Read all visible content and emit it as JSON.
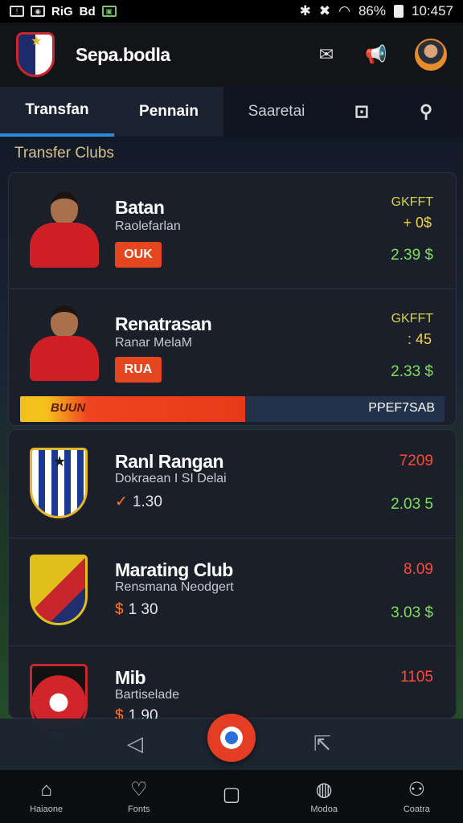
{
  "status_bar": {
    "left_icons": [
      "notification-icon",
      "camera-icon",
      "app-icon",
      "gallery-icon"
    ],
    "left_text": [
      "RiG",
      "Bd"
    ],
    "battery": "86%",
    "time": "10:457"
  },
  "app_bar": {
    "title": "Sepa.bodla",
    "actions": [
      "message-icon",
      "megaphone-icon",
      "avatar"
    ]
  },
  "tabs": [
    {
      "label": "Transfan",
      "active": true
    },
    {
      "label": "Pennain",
      "active": false
    },
    {
      "label": "Saaretai",
      "active": false
    }
  ],
  "section_label": "Transfer  Clubs",
  "players": [
    {
      "name": "Batan",
      "subtitle": "Raolefarlan",
      "badge": "OUK",
      "stat_top": "GKFFT",
      "stat_mid": "+ 0$",
      "stat_value": "2.39 $"
    },
    {
      "name": "Renatrasan",
      "subtitle": "Ranar MelaM",
      "badge": "RUA",
      "stat_top": "GKFFT",
      "stat_mid": ": 45",
      "stat_value": "2.33 $"
    }
  ],
  "progress": {
    "left_label": "BUUN",
    "right_label": "PPEF7SAB",
    "fill_percent": 53
  },
  "clubs": [
    {
      "name": "Ranl Rangan",
      "subtitle": "Dokraean I SI Delai",
      "meta_mark": "✓",
      "meta_value": "1.30",
      "top_value": "7209",
      "bottom_value": "2.03 5",
      "colors": {
        "top": "#ff4a3a"
      }
    },
    {
      "name": "Marating Club",
      "subtitle": "Rensmana Neodgert",
      "meta_mark": "$",
      "meta_value": "1 30",
      "top_value": "8.09",
      "bottom_value": "3.03 $",
      "colors": {
        "top": "#ff4a3a"
      }
    },
    {
      "name": "Mib",
      "subtitle": "Bartiselade",
      "meta_mark": "$",
      "meta_value": "1.90",
      "top_value": "1105",
      "bottom_value": "",
      "colors": {
        "top": "#ff4a3a"
      }
    }
  ],
  "bottom_sheet": {
    "left_icon": "back-arrow-icon",
    "right_icon": "share-icon"
  },
  "nav": [
    {
      "label": "Haiaone",
      "icon": "home-icon"
    },
    {
      "label": "Fonts",
      "icon": "heart-shield-icon"
    },
    {
      "label": "",
      "icon": "tablet-icon"
    },
    {
      "label": "Modoa",
      "icon": "ball-icon"
    },
    {
      "label": "Coatra",
      "icon": "user-icon"
    }
  ]
}
